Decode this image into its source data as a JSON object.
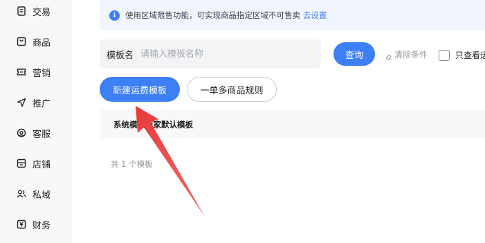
{
  "sidebar": {
    "items": [
      {
        "label": "交易",
        "icon": "document-icon"
      },
      {
        "label": "商品",
        "icon": "bag-icon"
      },
      {
        "label": "营销",
        "icon": "ticket-icon"
      },
      {
        "label": "推广",
        "icon": "send-icon"
      },
      {
        "label": "客服",
        "icon": "headset-icon"
      },
      {
        "label": "店铺",
        "icon": "store-icon"
      },
      {
        "label": "私域",
        "icon": "users-icon"
      },
      {
        "label": "财务",
        "icon": "currency-icon"
      }
    ]
  },
  "notice": {
    "text": "使用区域限售功能，可实现商品指定区域不可售卖",
    "link": "去设置"
  },
  "search": {
    "label": "模板名",
    "placeholder": "请输入模板名称"
  },
  "actions": {
    "query": "查询",
    "clear": "清除条件",
    "only_view": "只查看运",
    "new_template": "新建运费模板",
    "multi_rule": "一单多商品规则"
  },
  "table": {
    "header_system": "系统模板",
    "header_merchant": "商家默认模板",
    "count_text": "共 1 个模板"
  },
  "colors": {
    "accent": "#3d7ff5",
    "annotation_arrow": "#ee4a4a"
  }
}
